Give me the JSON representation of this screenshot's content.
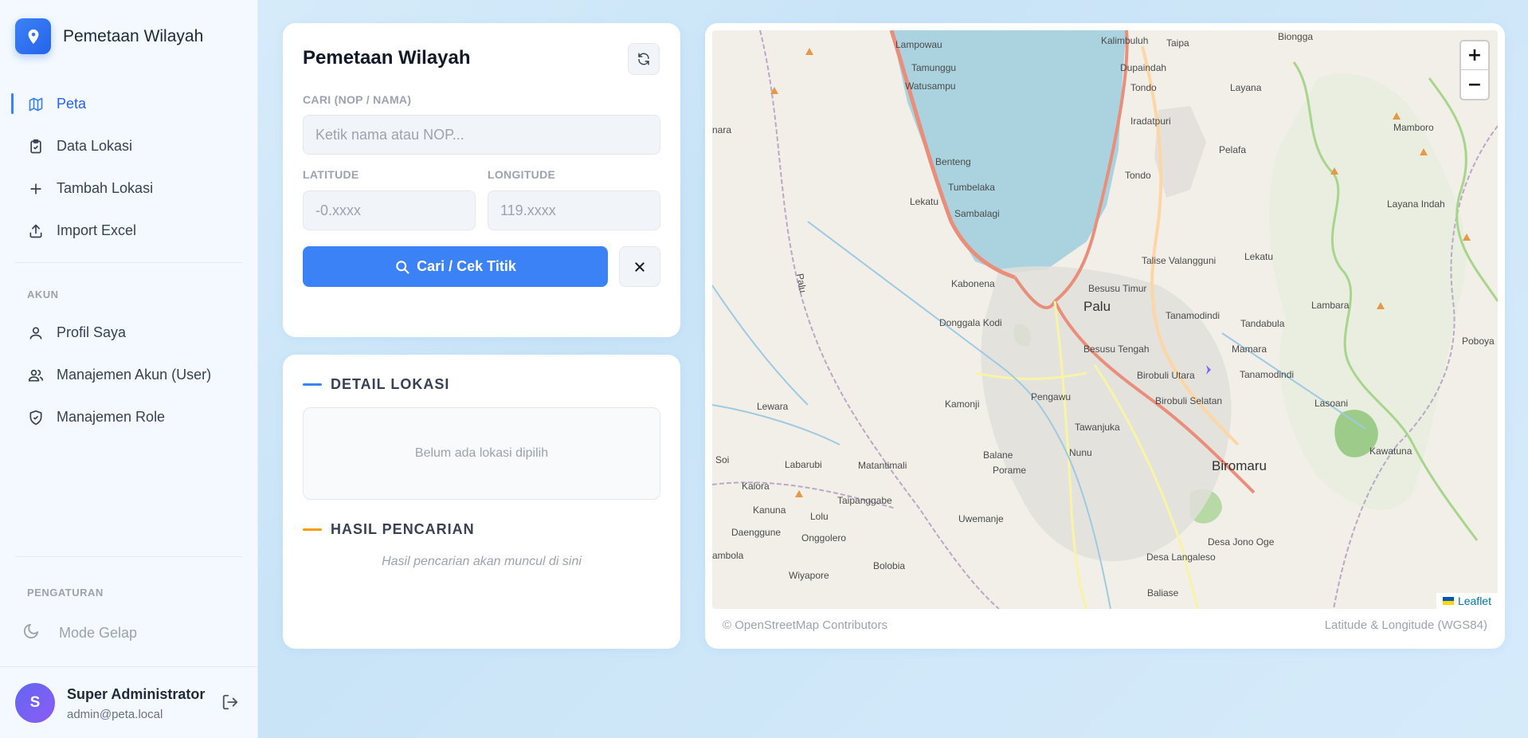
{
  "app": {
    "name": "Pemetaan Wilayah"
  },
  "sidebar": {
    "nav": [
      {
        "label": "Peta",
        "icon": "map-icon",
        "active": true
      },
      {
        "label": "Data Lokasi",
        "icon": "clipboard-icon"
      },
      {
        "label": "Tambah Lokasi",
        "icon": "plus-icon"
      },
      {
        "label": "Import Excel",
        "icon": "upload-icon"
      }
    ],
    "account_section": "AKUN",
    "account_nav": [
      {
        "label": "Profil Saya",
        "icon": "user-icon"
      },
      {
        "label": "Manajemen Akun (User)",
        "icon": "users-icon"
      },
      {
        "label": "Manajemen Role",
        "icon": "shield-icon"
      }
    ],
    "settings_section": "PENGATURAN",
    "dark_mode_label": "Mode Gelap",
    "user": {
      "initial": "S",
      "name": "Super Administrator",
      "email": "admin@peta.local"
    }
  },
  "search_panel": {
    "title": "Pemetaan Wilayah",
    "search_label": "CARI (NOP / NAMA)",
    "search_placeholder": "Ketik nama atau NOP...",
    "latitude_label": "LATITUDE",
    "latitude_placeholder": "-0.xxxx",
    "longitude_label": "LONGITUDE",
    "longitude_placeholder": "119.xxxx",
    "search_button": "Cari / Cek Titik"
  },
  "detail_panel": {
    "detail_heading": "DETAIL LOKASI",
    "detail_empty": "Belum ada lokasi dipilih",
    "results_heading": "HASIL PENCARIAN",
    "results_empty": "Hasil pencarian akan muncul di sini",
    "colors": {
      "detail_accent": "#3b82f6",
      "results_accent": "#f59e0b"
    }
  },
  "map": {
    "zoom_in": "+",
    "zoom_out": "−",
    "attribution_link": "Leaflet",
    "footer_left": "© OpenStreetMap Contributors",
    "footer_right": "Latitude & Longitude (WGS84)",
    "places": {
      "lampowau": "Lampowau",
      "kalimbuluh": "Kalimbuluh",
      "taipa": "Taipa",
      "biongga": "Biongga",
      "tamunggu": "Tamunggu",
      "dupaindah": "Dupaindah",
      "watusampu": "Watusampu",
      "tondo1": "Tondo",
      "layana": "Layana",
      "nara": "nara",
      "iradatpuri": "Iradatpuri",
      "mamboro": "Mamboro",
      "pelafa": "Pelafa",
      "benteng": "Benteng",
      "tumbelaka": "Tumbelaka",
      "tondo2": "Tondo",
      "lekatu": "Lekatu",
      "sambalagi": "Sambalagi",
      "layana_indah": "Layana Indah",
      "talise": "Talise Valangguni",
      "lekatu2": "Lekatu",
      "kabonena": "Kabonena",
      "besusu_timur": "Besusu Timur",
      "palu": "Palu",
      "lambara": "Lambara",
      "tanamodindi": "Tanamodindi",
      "donggala_kodi": "Donggala Kodi",
      "tandabula": "Tandabula",
      "poboya": "Poboya",
      "besusu_tengah": "Besusu Tengah",
      "mamara": "Mamara",
      "birobuli_utara": "Birobuli Utara",
      "tanamodindi2": "Tanamodindi",
      "pengawu": "Pengawu",
      "lewara": "Lewara",
      "kamonji": "Kamonji",
      "birobuli_selatan": "Birobuli Selatan",
      "lasoani": "Lasoani",
      "tawanjuka": "Tawanjuka",
      "palu_river": "Palu",
      "soi": "Soi",
      "labarubi": "Labarubi",
      "matantimali": "Matantimali",
      "balane": "Balane",
      "nunu": "Nunu",
      "biromaru": "Biromaru",
      "kawatuna": "Kawatuna",
      "kalora": "Kalora",
      "porame": "Porame",
      "taipanggabe": "Taipanggabe",
      "kanuna": "Kanuna",
      "lolu": "Lolu",
      "uwemanje": "Uwemanje",
      "daenggune": "Daenggune",
      "onggolero": "Onggolero",
      "desa_jono_oge": "Desa Jono Oge",
      "ambola": "ambola",
      "desa_langaleso": "Desa Langaleso",
      "bolobia": "Bolobia",
      "wiyapore": "Wiyapore",
      "baliase": "Baliase"
    }
  }
}
